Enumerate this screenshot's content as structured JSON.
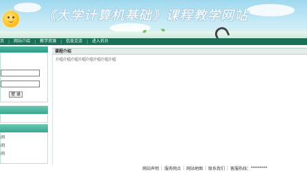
{
  "header": {
    "site_title": "《大学计算机基础》课程教学网站"
  },
  "nav": {
    "items": [
      "页",
      "网站介绍",
      "教学资源",
      "信息交流",
      "进入后台"
    ]
  },
  "sidebar": {
    "login_button": "登 录",
    "list_marks": [
      "间",
      "间",
      "间"
    ]
  },
  "main": {
    "section_title": "课程介绍",
    "intro_text": "介绍介绍介绍介绍介绍介绍介绍介绍"
  },
  "footer": {
    "links": [
      "网站声明",
      "服务网点",
      "网站地图",
      "联系我们"
    ],
    "hotline_label": "客服热线：",
    "hotline_value": "********"
  },
  "colors": {
    "nav_bg": "#1c6f57",
    "sidebar_header": "#2a9c86",
    "banner_sky": "#9fd8ef"
  }
}
